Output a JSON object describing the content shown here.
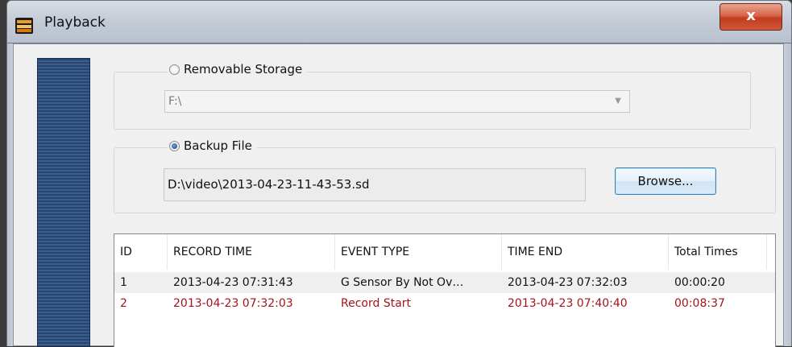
{
  "window": {
    "title": "Playback",
    "close_symbol": "x"
  },
  "removable": {
    "label": "Removable Storage",
    "selected": false,
    "drive_value": "F:\\"
  },
  "backup": {
    "label": "Backup File",
    "selected": true,
    "path": "D:\\video\\2013-04-23-11-43-53.sd",
    "browse_label": "Browse..."
  },
  "table": {
    "columns": [
      "ID",
      "RECORD TIME",
      "EVENT TYPE",
      "TIME END",
      "Total Times"
    ],
    "rows": [
      {
        "id": "1",
        "record_time": "2013-04-23 07:31:43",
        "event_type": "G Sensor By Not Ov…",
        "time_end": "2013-04-23 07:32:03",
        "total_times": "00:00:20",
        "color": "#111111"
      },
      {
        "id": "2",
        "record_time": "2013-04-23 07:32:03",
        "event_type": "Record Start",
        "time_end": "2013-04-23 07:40:40",
        "total_times": "00:08:37",
        "color": "#a3141c"
      }
    ]
  }
}
